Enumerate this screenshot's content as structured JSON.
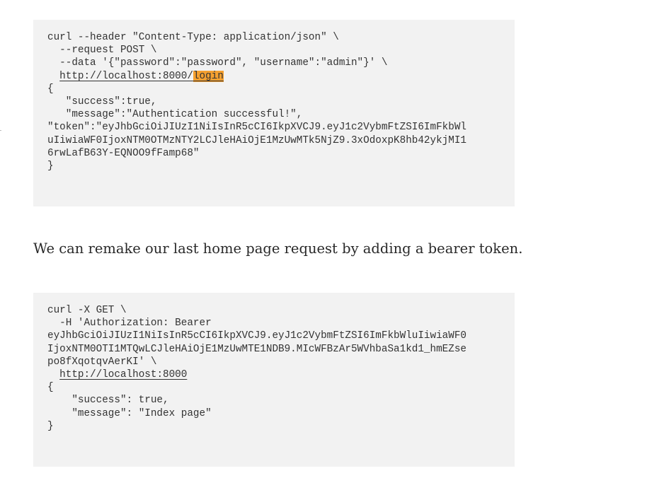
{
  "code_block_1": {
    "request": {
      "line1": "curl --header \"Content-Type: application/json\" \\",
      "line2": "  --request POST \\",
      "line3": "  --data '{\"password\":\"password\", \"username\":\"admin\"}' \\",
      "url_indent": "  ",
      "url_base": "http://localhost:8000/",
      "url_highlight": "login"
    },
    "response": {
      "line1": "{",
      "line2": "   \"success\":true,",
      "line3": "   \"message\":\"Authentication successful!\",",
      "line4": "\"token\":\"eyJhbGciOiJIUzI1NiIsInR5cCI6IkpXVCJ9.eyJ1c2VybmFtZSI6ImFkbWl",
      "line5": "uIiwiaWF0IjoxNTM0OTMzNTY2LCJleHAiOjE1MzUwMTk5NjZ9.3xOdoxpK8hb42ykjMI1",
      "line6": "6rwLafB63Y-EQNOO9fFamp68\"",
      "line7": "}"
    }
  },
  "paragraph": {
    "text": "We can remake our last home page request by adding a bearer token."
  },
  "code_block_2": {
    "request": {
      "line1": "curl -X GET \\",
      "line2": "  -H 'Authorization: Bearer",
      "line3": "eyJhbGciOiJIUzI1NiIsInR5cCI6IkpXVCJ9.eyJ1c2VybmFtZSI6ImFkbWluIiwiaWF0",
      "line4": "IjoxNTM0OTI1MTQwLCJleHAiOjE1MzUwMTE1NDB9.MIcWFBzAr5WVhbaSa1kd1_hmEZse",
      "line5": "po8fXqotqvAerKI' \\",
      "url_indent": "  ",
      "url": "http://localhost:8000"
    },
    "response": {
      "line1": "{",
      "line2": "    \"success\": true,",
      "line3": "    \"message\": \"Index page\"",
      "line4": "}"
    }
  },
  "colors": {
    "code_background": "#f2f2f2",
    "code_text": "#333333",
    "highlight": "#f5a030",
    "body_text": "#292929"
  }
}
